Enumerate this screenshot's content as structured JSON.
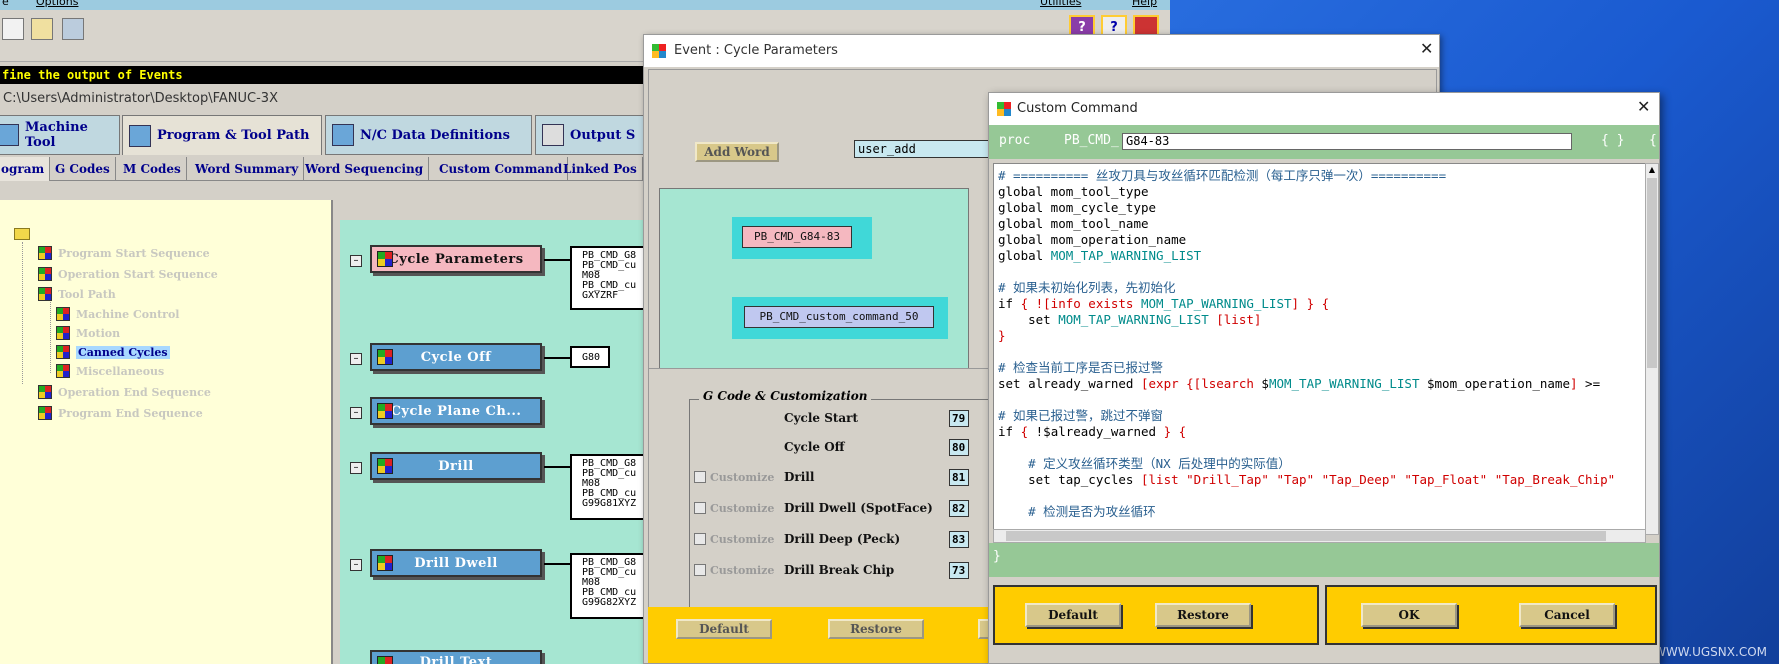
{
  "menubar": {
    "left_items": [
      "e",
      "Options"
    ],
    "right_items": [
      "Utilities",
      "Help"
    ]
  },
  "hint": "fine the output of Events",
  "path": "C:\\Users\\Administrator\\Desktop\\FANUC-3X",
  "main_tabs": [
    "Machine Tool",
    "Program & Tool Path",
    "N/C Data Definitions",
    "Output S"
  ],
  "sub_tabs": [
    "ogram",
    "G Codes",
    "M Codes",
    "Word Summary",
    "Word Sequencing",
    "Custom Command",
    "Linked Pos"
  ],
  "tree": {
    "items": [
      "Program Start Sequence",
      "Operation Start Sequence",
      "Tool Path",
      "Machine Control",
      "Motion",
      "Canned Cycles",
      "Miscellaneous",
      "Operation End Sequence",
      "Program End Sequence"
    ],
    "selected": "Canned Cycles"
  },
  "events": [
    {
      "label": "Cycle Parameters",
      "block": "PB_CMD_G8\nPB_CMD_cu\nM08\nPB_CMD_cu\nGXYZRF"
    },
    {
      "label": "Cycle Off",
      "block": "G80"
    },
    {
      "label": "Cycle Plane Ch..."
    },
    {
      "label": "Drill",
      "block": "PB_CMD_G8\nPB_CMD_cu\nM08\nPB_CMD_cu\nG99G81XYZ"
    },
    {
      "label": "Drill Dwell",
      "block": "PB_CMD_G8\nPB_CMD_cu\nM08\nPB_CMD_cu\nG99G82XYZ"
    },
    {
      "label": "Drill Text"
    }
  ],
  "event_window": {
    "title": "Event : Cycle Parameters",
    "add_word": "Add Word",
    "word_value": "user_add",
    "cmd1": "PB_CMD_G84-83",
    "cmd2": "PB_CMD_custom_command_50",
    "gcode_legend": "G Code & Customization",
    "customize_label": "Customize",
    "gcode_rows": [
      {
        "name": "Cycle Start",
        "value": "79",
        "has_customize": false
      },
      {
        "name": "Cycle Off",
        "value": "80",
        "has_customize": false
      },
      {
        "name": "Drill",
        "value": "81",
        "has_customize": true
      },
      {
        "name": "Drill Dwell (SpotFace)",
        "value": "82",
        "has_customize": true
      },
      {
        "name": "Drill Deep (Peck)",
        "value": "83",
        "has_customize": true
      },
      {
        "name": "Drill Break Chip",
        "value": "73",
        "has_customize": true
      }
    ],
    "buttons": {
      "default": "Default",
      "restore": "Restore"
    }
  },
  "custom_command": {
    "title": "Custom Command",
    "proc_label": "proc",
    "proc_prefix": "PB_CMD_",
    "proc_name": "G84-83",
    "braces": "{ }",
    "brace_partial": "{",
    "closing_brace": "}",
    "buttons": {
      "default": "Default",
      "restore": "Restore",
      "ok": "OK",
      "cancel": "Cancel"
    }
  },
  "code_lines": [
    [
      [
        "c-cm",
        "# ========== 丝攻刀具与攻丝循环匹配检测（每工序只弹一次）=========="
      ]
    ],
    [
      [
        "c-kw",
        "global mom_tool_type"
      ]
    ],
    [
      [
        "c-kw",
        "global mom_cycle_type"
      ]
    ],
    [
      [
        "c-kw",
        "global mom_tool_name"
      ]
    ],
    [
      [
        "c-kw",
        "global mom_operation_name"
      ]
    ],
    [
      [
        "c-kw",
        "global "
      ],
      [
        "c-v",
        "MOM_TAP_WARNING_LIST"
      ]
    ],
    [],
    [
      [
        "c-cm",
        "# 如果未初始化列表，先初始化"
      ]
    ],
    [
      [
        "c-kw",
        "if "
      ],
      [
        "c-r",
        "{ ![info exists "
      ],
      [
        "c-v",
        "MOM_TAP_WARNING_LIST"
      ],
      [
        "c-r",
        "] } {"
      ]
    ],
    [
      [
        "c-kw",
        "    set "
      ],
      [
        "c-v",
        "MOM_TAP_WARNING_LIST"
      ],
      [
        "c-r",
        " [list]"
      ]
    ],
    [
      [
        "c-r",
        "}"
      ]
    ],
    [],
    [
      [
        "c-cm",
        "# 检查当前工序是否已报过警"
      ]
    ],
    [
      [
        "c-kw",
        "set already_warned "
      ],
      [
        "c-r",
        "[expr {[lsearch "
      ],
      [
        "c-kw",
        "$"
      ],
      [
        "c-v",
        "MOM_TAP_WARNING_LIST"
      ],
      [
        "c-kw",
        " $mom_operation_name"
      ],
      [
        "c-r",
        "]"
      ],
      [
        "c-kw",
        " >="
      ]
    ],
    [],
    [
      [
        "c-cm",
        "# 如果已报过警，跳过不弹窗"
      ]
    ],
    [
      [
        "c-kw",
        "if "
      ],
      [
        "c-r",
        "{ "
      ],
      [
        "c-kw",
        "!$already_warned"
      ],
      [
        "c-r",
        " } {"
      ]
    ],
    [],
    [
      [
        "c-cm",
        "    # 定义攻丝循环类型（NX 后处理中的实际值）"
      ]
    ],
    [
      [
        "c-kw",
        "    set tap_cycles "
      ],
      [
        "c-r",
        "[list \"Drill_Tap\" \"Tap\" \"Tap_Deep\" \"Tap_Float\" \"Tap_Break_Chip\""
      ]
    ],
    [],
    [
      [
        "c-cm",
        "    # 检测是否为攻丝循环"
      ]
    ]
  ],
  "watermark": "UG爱好者论坛 WWW.UGSNX.COM",
  "colors": {
    "canvas": "#a6e6d2",
    "tree_bg": "#ffffd8",
    "event_pink": "#f5b8c0",
    "event_blue": "#5d9fd0",
    "button_bar": "#ffcc00",
    "proc_bar": "#96c896"
  }
}
